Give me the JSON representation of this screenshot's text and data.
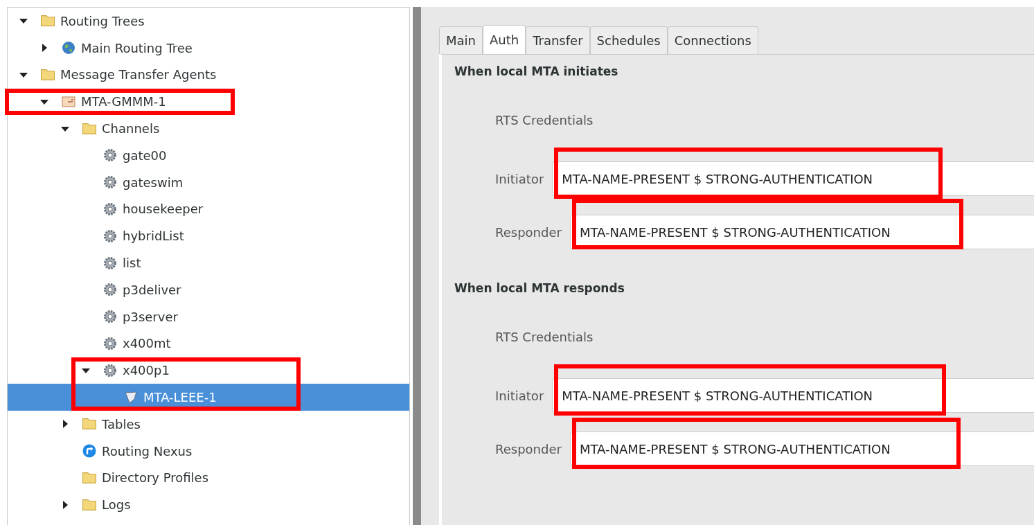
{
  "tree": [
    {
      "label": "Routing Trees",
      "kind": "folder",
      "expanded": true,
      "selected": false,
      "children": [
        {
          "label": "Main Routing Tree",
          "kind": "globe",
          "expanded": false,
          "selected": false
        }
      ]
    },
    {
      "label": "Message Transfer Agents",
      "kind": "folder",
      "expanded": true,
      "selected": false,
      "children": [
        {
          "label": "MTA-GMMM-1",
          "kind": "mta",
          "expanded": true,
          "selected": false,
          "children": [
            {
              "label": "Channels",
              "kind": "folder",
              "expanded": true,
              "selected": false,
              "children": [
                {
                  "label": "gate00",
                  "kind": "gear",
                  "selected": false
                },
                {
                  "label": "gateswim",
                  "kind": "gear",
                  "selected": false
                },
                {
                  "label": "housekeeper",
                  "kind": "gear",
                  "selected": false
                },
                {
                  "label": "hybridList",
                  "kind": "gear",
                  "selected": false
                },
                {
                  "label": "list",
                  "kind": "gear",
                  "selected": false
                },
                {
                  "label": "p3deliver",
                  "kind": "gear",
                  "selected": false
                },
                {
                  "label": "p3server",
                  "kind": "gear",
                  "selected": false
                },
                {
                  "label": "x400mt",
                  "kind": "gear",
                  "selected": false
                },
                {
                  "label": "x400p1",
                  "kind": "gear",
                  "expanded": true,
                  "selected": false,
                  "children": [
                    {
                      "label": "MTA-LEEE-1",
                      "kind": "peer",
                      "selected": true
                    }
                  ]
                }
              ]
            },
            {
              "label": "Tables",
              "kind": "folder",
              "expanded": false,
              "selected": false
            },
            {
              "label": "Routing Nexus",
              "kind": "nexus",
              "selected": false
            },
            {
              "label": "Directory Profiles",
              "kind": "folder",
              "selected": false
            },
            {
              "label": "Logs",
              "kind": "folder",
              "expanded": false,
              "selected": false
            }
          ]
        }
      ]
    }
  ],
  "tabs": [
    {
      "label": "Main",
      "selected": false
    },
    {
      "label": "Auth",
      "selected": true
    },
    {
      "label": "Transfer",
      "selected": false
    },
    {
      "label": "Schedules",
      "selected": false
    },
    {
      "label": "Connections",
      "selected": false
    }
  ],
  "sections": [
    {
      "heading": "When local MTA initiates",
      "subheading": "RTS Credentials",
      "fields": [
        {
          "label": "Initiator",
          "value": "MTA-NAME-PRESENT $ STRONG-AUTHENTICATION"
        },
        {
          "label": "Responder",
          "value": "MTA-NAME-PRESENT $ STRONG-AUTHENTICATION"
        }
      ]
    },
    {
      "heading": "When local MTA responds",
      "subheading": "RTS Credentials",
      "fields": [
        {
          "label": "Initiator",
          "value": "MTA-NAME-PRESENT $ STRONG-AUTHENTICATION"
        },
        {
          "label": "Responder",
          "value": "MTA-NAME-PRESENT $ STRONG-AUTHENTICATION"
        }
      ]
    }
  ]
}
